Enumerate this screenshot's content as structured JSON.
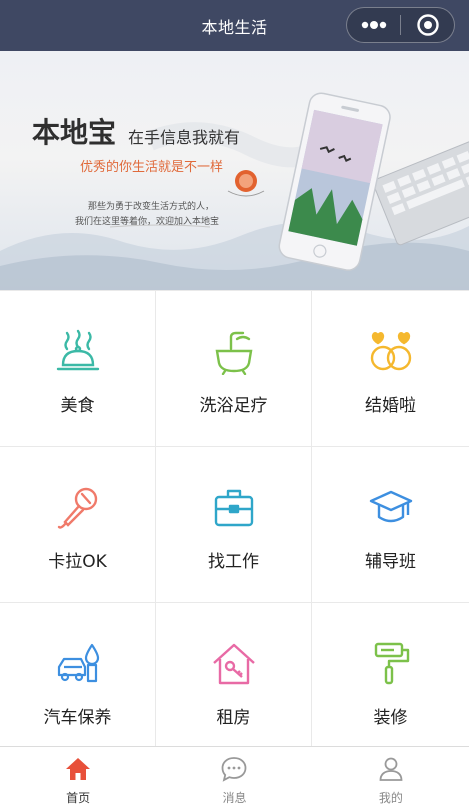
{
  "navbar": {
    "title": "本地生活",
    "background_color": "#3f4863",
    "capsule": {
      "more_icon": "more-dots-icon",
      "close_icon": "target-close-icon"
    }
  },
  "banner": {
    "title_main": "本地宝",
    "title_sub": "在手信息我就有",
    "slogan": "优秀的你生活就是不一样",
    "desc_line1": "那些为勇于改变生活方式的人，",
    "desc_line2": "我们在这里等着你，欢迎加入本地宝"
  },
  "grid": {
    "items": [
      {
        "label": "美食",
        "icon": "food-cloche-icon",
        "color": "#3bb9a6"
      },
      {
        "label": "洗浴足疗",
        "icon": "bathtub-icon",
        "color": "#7cc14a"
      },
      {
        "label": "结婚啦",
        "icon": "wedding-rings-icon",
        "color": "#f5b82e"
      },
      {
        "label": "卡拉OK",
        "icon": "microphone-icon",
        "color": "#f07a6a"
      },
      {
        "label": "找工作",
        "icon": "briefcase-icon",
        "color": "#2fa6c9"
      },
      {
        "label": "辅导班",
        "icon": "graduation-cap-icon",
        "color": "#3d8fe0"
      },
      {
        "label": "汽车保养",
        "icon": "car-care-icon",
        "color": "#3d8fe0"
      },
      {
        "label": "租房",
        "icon": "house-key-icon",
        "color": "#e86aa5"
      },
      {
        "label": "装修",
        "icon": "paint-roller-icon",
        "color": "#7cc14a"
      }
    ]
  },
  "tabbar": {
    "tabs": [
      {
        "label": "首页",
        "icon": "home-icon",
        "active": true,
        "color": "#e8503a"
      },
      {
        "label": "消息",
        "icon": "message-bubble-icon",
        "active": false,
        "color": "#999999"
      },
      {
        "label": "我的",
        "icon": "user-profile-icon",
        "active": false,
        "color": "#999999"
      }
    ]
  }
}
